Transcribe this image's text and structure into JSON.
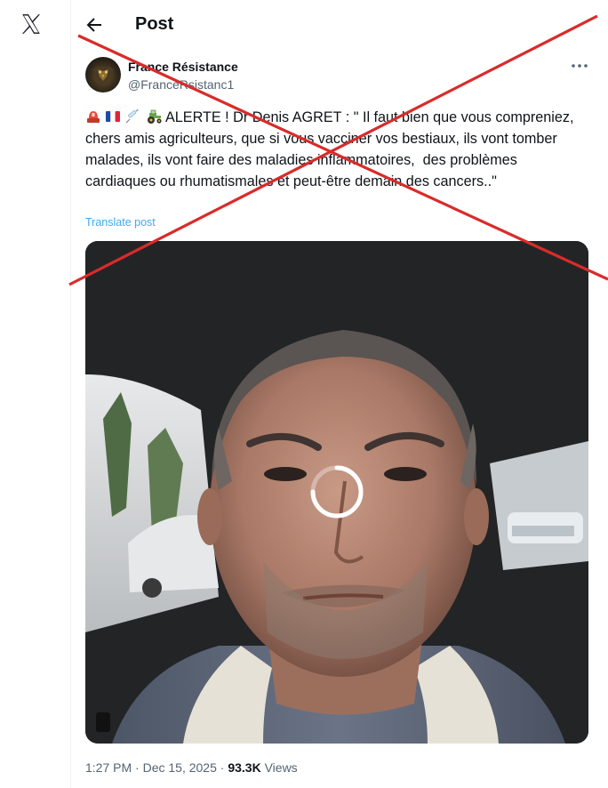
{
  "nav": {
    "logo_icon": "x-logo-icon",
    "back_icon": "arrow-left-icon",
    "title": "Post"
  },
  "author": {
    "display_name": "France Résistance",
    "handle": "@FranceRsistanc1",
    "avatar": "eagle-avatar",
    "more_icon": "more-horizontal-icon"
  },
  "tweet": {
    "emojis": [
      "police-light-emoji",
      "france-flag-emoji",
      "syringe-emoji",
      "tractor-emoji"
    ],
    "text": "ALERTE ! Dr Denis AGRET : \" Il faut bien que vous compreniez, chers amis agriculteurs, que si vous vacciner vos bestiaux, ils vont tomber malades, ils vont faire des maladies inflammatoires,  des problèmes cardiaques ou rhumatismales et peut-être demain des cancers..\"",
    "translate_label": "Translate post"
  },
  "media": {
    "type": "video",
    "loading_icon": "loading-spinner-icon"
  },
  "meta": {
    "time": "1:27 PM",
    "separator": "·",
    "date": "Dec 15, 2025",
    "views_count": "93.3K",
    "views_label": "Views"
  },
  "overlay": {
    "cross_color": "#d92b2b"
  }
}
